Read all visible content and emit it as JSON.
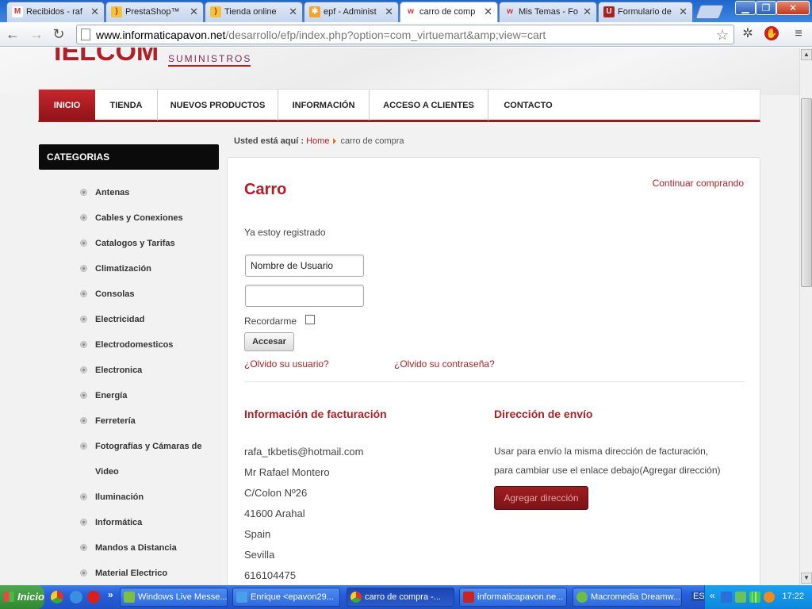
{
  "browser": {
    "tabs": [
      {
        "label": "Recibidos - raf",
        "favicon": "gmail-icon"
      },
      {
        "label": "PrestaShop™",
        "favicon": "prestashop-icon"
      },
      {
        "label": "Tienda online",
        "favicon": "prestashop-icon"
      },
      {
        "label": "epf - Administ",
        "favicon": "joomla-icon"
      },
      {
        "label": "carro de comp",
        "favicon": "virtuemart-icon",
        "active": true
      },
      {
        "label": "Mis Temas - Fo",
        "favicon": "virtuemart-icon"
      },
      {
        "label": "Formulario de",
        "favicon": "formulario-icon"
      }
    ],
    "url_host": "www.informaticapavon.net",
    "url_path": "/desarrollo/efp/index.php?option=com_virtuemart&amp;view=cart"
  },
  "site": {
    "logo": "IELCOM",
    "logo_sub": "SUMINISTROS",
    "nav": [
      "INICIO",
      "TIENDA",
      "NUEVOS PRODUCTOS",
      "INFORMACIÓN",
      "ACCESO A CLIENTES",
      "CONTACTO"
    ],
    "categories_title": "CATEGORIAS",
    "categories": [
      "Antenas",
      "Cables y Conexiones",
      "Catalogos y Tarifas",
      "Climatización",
      "Consolas",
      "Electricidad",
      "Electrodomesticos",
      "Electronica",
      "Energía",
      "Ferretería",
      "Fotografías y Cámaras de",
      "Video",
      "Iluminación",
      "Informática",
      "Mandos a Distancia",
      "Material Electrico"
    ],
    "breadcrumb": {
      "prefix": "Usted está aquí :",
      "home": "Home",
      "current": "carro de compra"
    }
  },
  "cart": {
    "title": "Carro",
    "continue": "Continuar comprando",
    "registered": "Ya estoy registrado",
    "username_placeholder": "Nombre de Usuario",
    "password_value": "",
    "remember": "Recordarme",
    "login": "Accesar",
    "forgot_user": "¿Olvido su usuario?",
    "forgot_pass": "¿Olvido su contraseña?",
    "billing_title": "Información de facturación",
    "billing": [
      "rafa_tkbetis@hotmail.com",
      "Mr Rafael Montero",
      "C/Colon Nº26",
      "41600 Arahal",
      "Spain",
      "Sevilla",
      "616104475"
    ],
    "shipping_title": "Dirección de envío",
    "shipping_note_1": "Usar para envío la misma dirección de facturación,",
    "shipping_note_2": "para cambiar use el enlace debajo(Agregar dirección)",
    "add_address": "Agregar dirección"
  },
  "taskbar": {
    "start": "Inicio",
    "tasks": [
      {
        "label": "Windows Live Messe..."
      },
      {
        "label": "Enrique <epavon29..."
      },
      {
        "label": "carro de compra -...",
        "active": true
      },
      {
        "label": "informaticapavon.ne..."
      },
      {
        "label": "Macromedia Dreamw..."
      }
    ],
    "lang": "ES",
    "clock": "17:22"
  },
  "colors": {
    "accent": "#b01f24",
    "nav_active": "#c8262b"
  }
}
